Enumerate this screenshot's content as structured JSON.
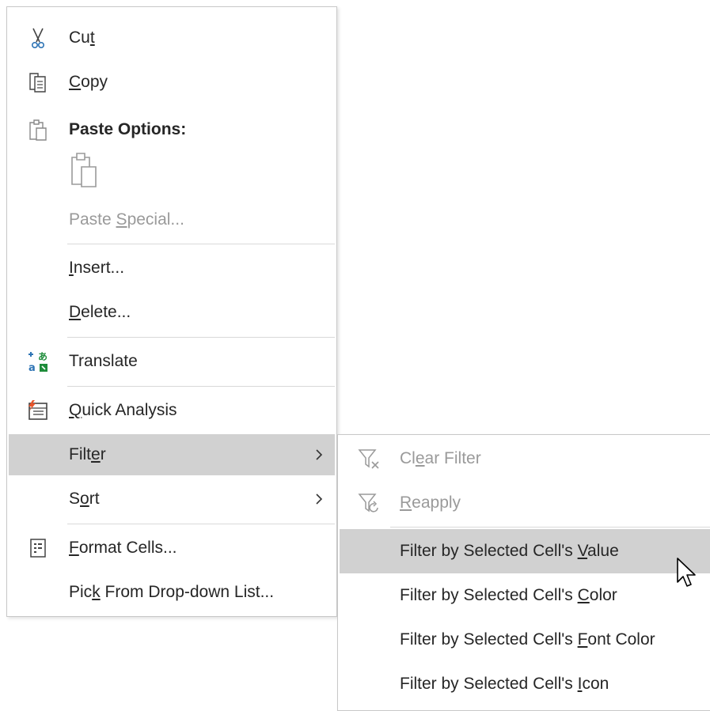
{
  "context_menu": {
    "items": [
      {
        "pre": "Cu",
        "key": "t",
        "post": ""
      },
      {
        "pre": "",
        "key": "C",
        "post": "opy"
      },
      {
        "pre": "Paste Options:",
        "key": "",
        "post": ""
      },
      {
        "pre": "Paste ",
        "key": "S",
        "post": "pecial..."
      },
      {
        "pre": "",
        "key": "I",
        "post": "nsert..."
      },
      {
        "pre": "",
        "key": "D",
        "post": "elete..."
      },
      {
        "pre": "Translate",
        "key": "",
        "post": ""
      },
      {
        "pre": "",
        "key": "Q",
        "post": "uick Analysis"
      },
      {
        "pre": "Filt",
        "key": "e",
        "post": "r"
      },
      {
        "pre": "S",
        "key": "o",
        "post": "rt"
      },
      {
        "pre": "",
        "key": "F",
        "post": "ormat Cells..."
      },
      {
        "pre": "Pic",
        "key": "k",
        "post": " From Drop-down List..."
      }
    ]
  },
  "filter_submenu": {
    "items": [
      {
        "pre": "Cl",
        "key": "e",
        "post": "ar Filter"
      },
      {
        "pre": "",
        "key": "R",
        "post": "eapply"
      },
      {
        "pre": "Filter by Selected Cell's ",
        "key": "V",
        "post": "alue"
      },
      {
        "pre": "Filter by Selected Cell's ",
        "key": "C",
        "post": "olor"
      },
      {
        "pre": "Filter by Selected Cell's ",
        "key": "F",
        "post": "ont Color"
      },
      {
        "pre": "Filter by Selected Cell's ",
        "key": "I",
        "post": "con"
      }
    ]
  },
  "colors": {
    "highlight": "#d1d1d1",
    "text": "#262626",
    "disabled_text": "#9a9a9a",
    "separator": "#d9d9d9"
  },
  "icons": {
    "cut": "scissors-icon",
    "copy": "copy-icon",
    "paste_options": "clipboard-icon",
    "paste": "paste-icon",
    "translate": "translate-icon",
    "quick_analysis": "quick-analysis-icon",
    "format_cells": "format-cells-icon",
    "clear_filter": "clear-filter-icon",
    "reapply": "reapply-filter-icon"
  }
}
